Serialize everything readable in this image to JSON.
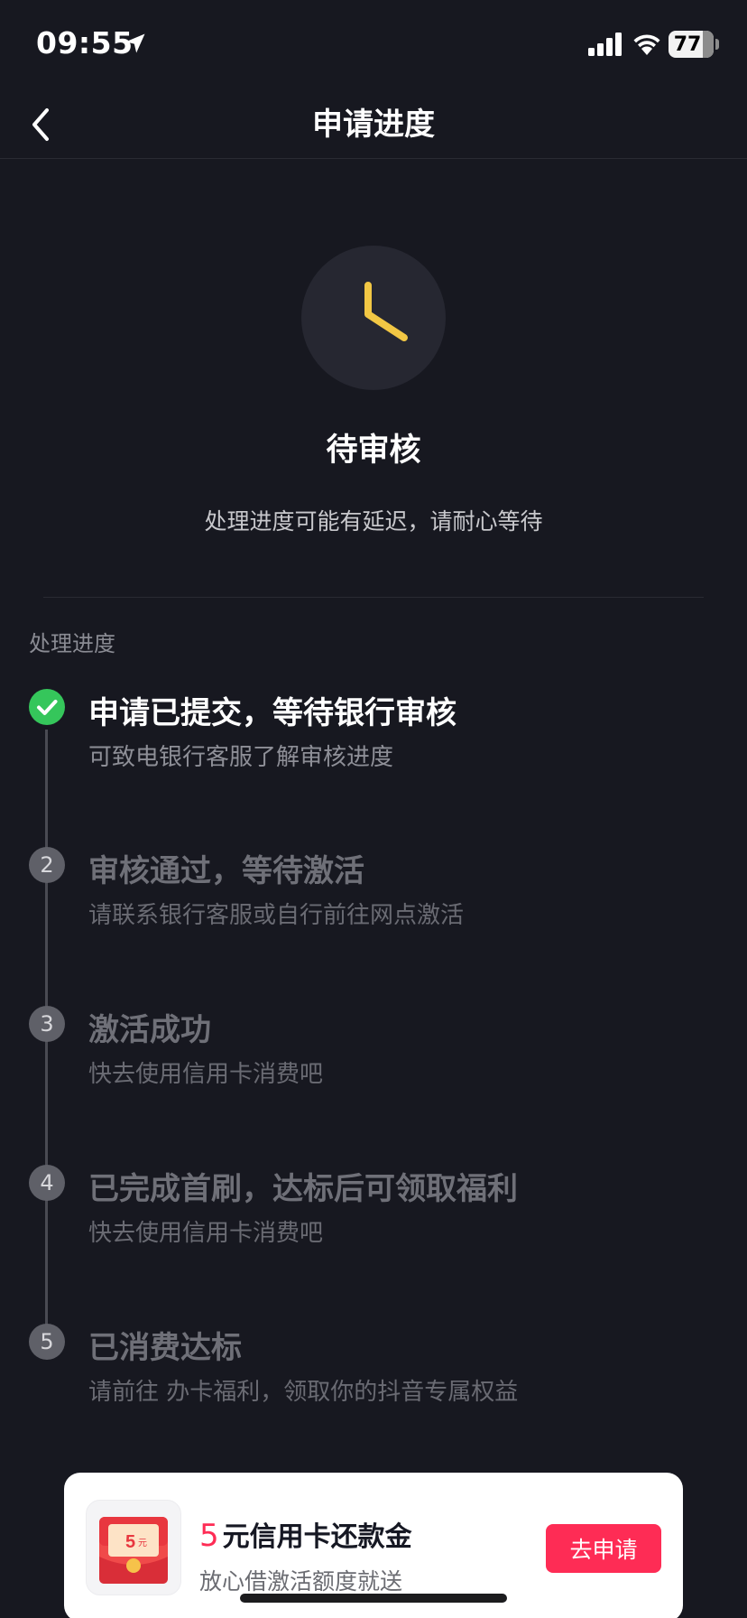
{
  "status_bar": {
    "time": "09:55",
    "battery": "77",
    "icons": [
      "location-arrow-icon",
      "signal-icon",
      "wifi-icon",
      "battery-icon"
    ]
  },
  "nav": {
    "title": "申请进度",
    "back_icon": "chevron-left-icon"
  },
  "hero": {
    "icon": "clock-icon",
    "icon_color": "#f2c744",
    "status": "待审核",
    "description": "处理进度可能有延迟，请耐心等待"
  },
  "progress": {
    "label": "处理进度",
    "steps": [
      {
        "marker": "",
        "title": "申请已提交，等待银行审核",
        "subtitle": "可致电银行客服了解审核进度",
        "state": "done"
      },
      {
        "marker": "2",
        "title": "审核通过，等待激活",
        "subtitle": "请联系银行客服或自行前往网点激活",
        "state": "pending"
      },
      {
        "marker": "3",
        "title": "激活成功",
        "subtitle": "快去使用信用卡消费吧",
        "state": "pending"
      },
      {
        "marker": "4",
        "title": "已完成首刷，达标后可领取福利",
        "subtitle": "快去使用信用卡消费吧",
        "state": "pending"
      },
      {
        "marker": "5",
        "title": "已消费达标",
        "subtitle": "请前往 办卡福利，领取你的抖音专属权益",
        "state": "pending"
      }
    ]
  },
  "promo": {
    "amount": "5",
    "title": "元信用卡还款金",
    "subtitle": "放心借激活额度就送",
    "button": "去申请",
    "thumb_amount": "5",
    "thumb_unit": "元",
    "accent": "#fe2c55"
  },
  "colors": {
    "background": "#171820",
    "done": "#35c65b"
  }
}
